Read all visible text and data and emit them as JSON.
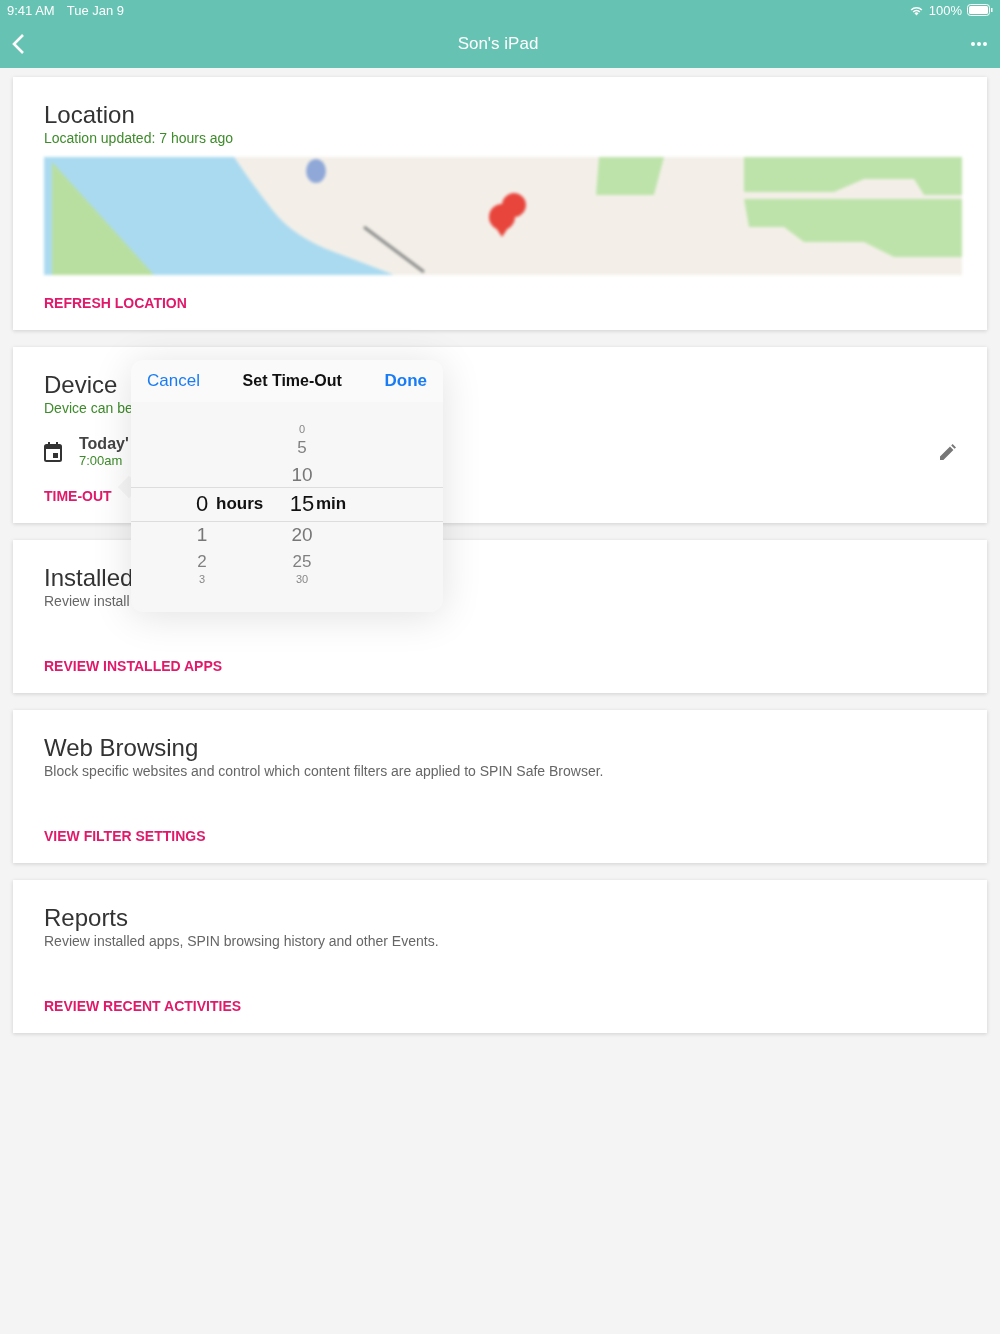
{
  "status_bar": {
    "time": "9:41 AM",
    "date": "Tue Jan 9",
    "battery": "100%"
  },
  "nav_bar": {
    "title": "Son's iPad"
  },
  "cards": [
    {
      "kind": "map",
      "title": "Location",
      "subtitle": "Location updated: 7 hours ago",
      "action": "REFRESH LOCATION"
    },
    {
      "kind": "schedule",
      "title": "Device",
      "subtitle": "Device can be",
      "schedule": {
        "label": "Today'",
        "time": "7:00am"
      },
      "action": "TIME-OUT"
    },
    {
      "kind": "plain",
      "title": "Installed",
      "subtitle": "Review install",
      "action": "REVIEW INSTALLED APPS"
    },
    {
      "kind": "plain",
      "title": "Web Browsing",
      "subtitle": "Block specific websites and control which content filters are applied to SPIN Safe Browser.",
      "action": "VIEW FILTER SETTINGS"
    },
    {
      "kind": "plain",
      "title": "Reports",
      "subtitle": "Review installed apps, SPIN browsing history and other Events.",
      "action": "REVIEW RECENT ACTIVITIES"
    }
  ],
  "popover": {
    "cancel": "Cancel",
    "title": "Set Time-Out",
    "done": "Done",
    "columns": [
      {
        "unit": "hours",
        "items": [
          {
            "value": "0",
            "selected": true
          },
          {
            "value": "1",
            "selected": false
          },
          {
            "value": "2",
            "selected": false
          },
          {
            "value": "3",
            "selected": false
          }
        ]
      },
      {
        "unit": "min",
        "items": [
          {
            "value": "0",
            "selected": false
          },
          {
            "value": "5",
            "selected": false
          },
          {
            "value": "10",
            "selected": false
          },
          {
            "value": "15",
            "selected": true
          },
          {
            "value": "20",
            "selected": false
          },
          {
            "value": "25",
            "selected": false
          },
          {
            "value": "30",
            "selected": false
          }
        ]
      }
    ]
  }
}
